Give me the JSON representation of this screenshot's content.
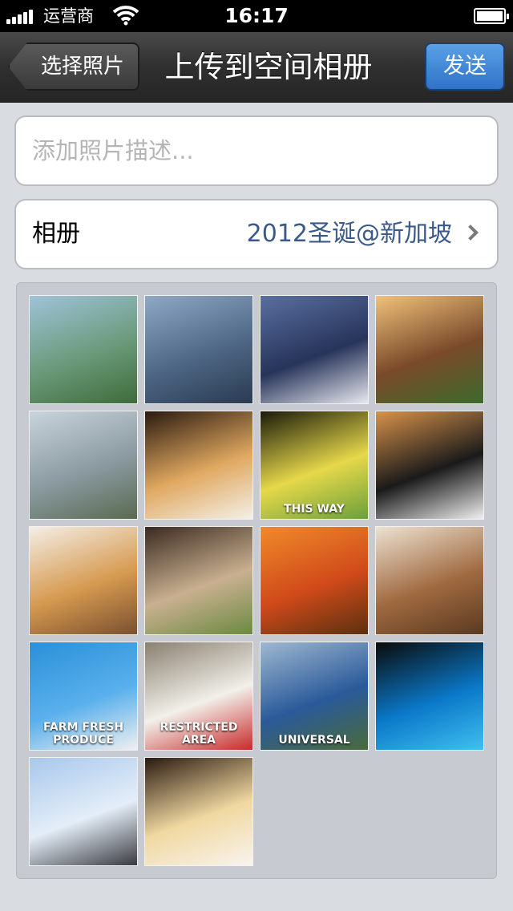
{
  "status_bar": {
    "carrier": "运营商",
    "time": "16:17"
  },
  "nav": {
    "back_label": "选择照片",
    "title": "上传到空间相册",
    "send_label": "发送"
  },
  "description": {
    "placeholder": "添加照片描述..."
  },
  "album": {
    "label": "相册",
    "value": "2012圣诞@新加坡"
  },
  "photos": [
    {
      "name": "photo-gardens-by-the-bay",
      "colors": [
        "#9fc3d9",
        "#6a9a7a",
        "#3f6b3a"
      ]
    },
    {
      "name": "photo-infinity-pool-skyline",
      "colors": [
        "#8fa8c4",
        "#4e6785",
        "#2a3a50"
      ]
    },
    {
      "name": "photo-pool-loungers",
      "colors": [
        "#5a6fa0",
        "#27345a",
        "#e8e8ee"
      ]
    },
    {
      "name": "photo-drinks-and-food",
      "colors": [
        "#f0c27a",
        "#7a4a2a",
        "#3c6a2c"
      ]
    },
    {
      "name": "photo-sentosa-aerial",
      "colors": [
        "#c9d4dc",
        "#8a9aa0",
        "#5a6a50"
      ]
    },
    {
      "name": "photo-kaya-toast-breakfast",
      "colors": [
        "#2a1a10",
        "#e0a860",
        "#f4f0e8"
      ]
    },
    {
      "name": "photo-this-way-panda-sign",
      "colors": [
        "#1a1a0a",
        "#e6d84a",
        "#6aa03a"
      ],
      "text": "THIS WAY"
    },
    {
      "name": "photo-giraffe-car-zebra",
      "colors": [
        "#d8924a",
        "#1a1a1a",
        "#f0f0f0"
      ]
    },
    {
      "name": "photo-waffle-ice-cream",
      "colors": [
        "#f4eee6",
        "#d69a50",
        "#7a5030"
      ]
    },
    {
      "name": "photo-coffee-sandwich",
      "colors": [
        "#3a2a20",
        "#c9b090",
        "#6a8a40"
      ]
    },
    {
      "name": "photo-orange-cocktails",
      "colors": [
        "#f08a2a",
        "#d04a1a",
        "#5a3010"
      ]
    },
    {
      "name": "photo-bak-kut-teh",
      "colors": [
        "#ede2d2",
        "#a06a40",
        "#5a3a20"
      ]
    },
    {
      "name": "photo-farm-fresh-produce-wall",
      "colors": [
        "#2a90d8",
        "#5ab0ec",
        "#f0f0f0"
      ],
      "text": "FARM FRESH PRODUCE"
    },
    {
      "name": "photo-restricted-area-sign",
      "colors": [
        "#8a8070",
        "#f2f0ea",
        "#c82a2a"
      ],
      "text": "RESTRICTED AREA"
    },
    {
      "name": "photo-universal-globe",
      "colors": [
        "#9fb8d0",
        "#2a5a9a",
        "#4a6a3a"
      ],
      "text": "UNIVERSAL"
    },
    {
      "name": "photo-night-pool",
      "colors": [
        "#0a0a0a",
        "#0a78c8",
        "#40c0f0"
      ]
    },
    {
      "name": "photo-merlion-skyline",
      "colors": [
        "#a8c8ec",
        "#e4eef8",
        "#3a3a40"
      ]
    },
    {
      "name": "photo-toast-and-coffee",
      "colors": [
        "#2a1a10",
        "#f0d8a0",
        "#f8f4ee"
      ]
    }
  ]
}
